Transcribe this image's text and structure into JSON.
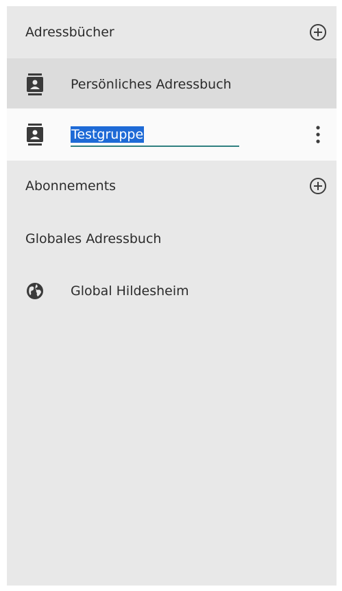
{
  "addressbooks": {
    "title": "Adressbücher",
    "add_icon": "plus-circle-icon",
    "items": [
      {
        "label": "Persönliches Adressbuch",
        "icon": "contact-card-icon",
        "state": "selected"
      },
      {
        "label": "Testgruppe",
        "icon": "contact-card-icon",
        "state": "editing",
        "menu_icon": "vertical-dots-icon"
      }
    ]
  },
  "subscriptions": {
    "title": "Abonnements",
    "add_icon": "plus-circle-icon"
  },
  "global": {
    "title": "Globales Adressbuch",
    "items": [
      {
        "label": "Global Hildesheim",
        "icon": "globe-icon"
      }
    ]
  },
  "colors": {
    "panel_background": "#e8e8e8",
    "selected_row": "#dcdcdc",
    "editing_row": "#fafafa",
    "text_selection": "#1e6ad6",
    "input_underline": "#2f8080"
  }
}
